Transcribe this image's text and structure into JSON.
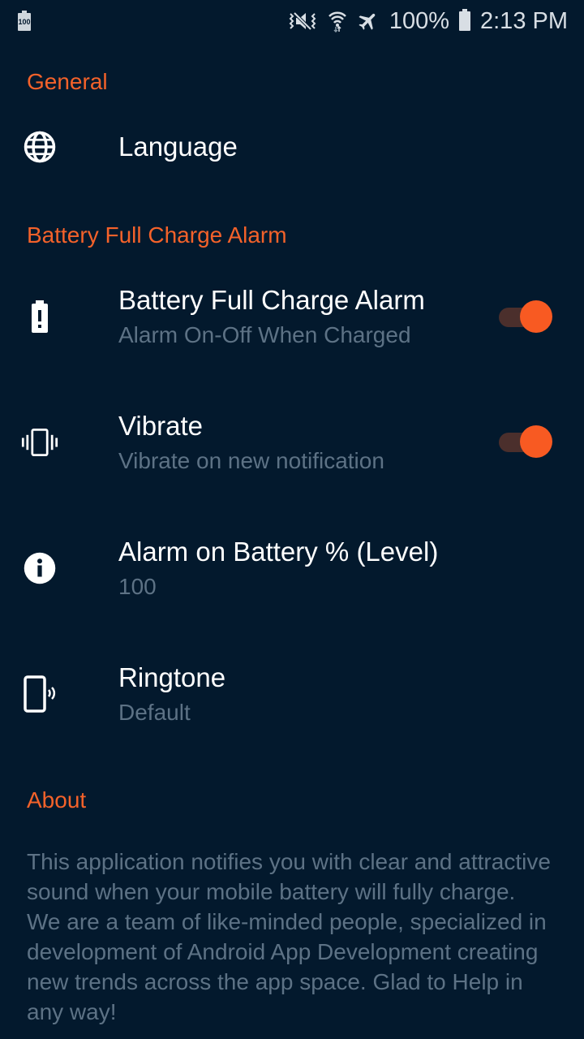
{
  "status_bar": {
    "left_icon": "battery-100-notification-icon",
    "left_icon_text": "100",
    "icons": [
      "vibrate-mute-icon",
      "wifi-icon",
      "airplane-mode-icon"
    ],
    "battery_percent": "100%",
    "time": "2:13 PM"
  },
  "sections": {
    "general": "General",
    "battery_alarm": "Battery Full Charge Alarm",
    "about": "About"
  },
  "settings": {
    "language": {
      "title": "Language",
      "icon": "globe-icon"
    },
    "battery_alarm": {
      "title": "Battery Full Charge Alarm",
      "subtitle": "Alarm On-Off When Charged",
      "icon": "battery-alert-icon",
      "enabled": true
    },
    "vibrate": {
      "title": "Vibrate",
      "subtitle": "Vibrate on new notification",
      "icon": "vibrate-icon",
      "enabled": true
    },
    "alarm_level": {
      "title": "Alarm on Battery % (Level)",
      "value": "100",
      "icon": "info-icon"
    },
    "ringtone": {
      "title": "Ringtone",
      "value": "Default",
      "icon": "ringtone-phone-icon"
    }
  },
  "about_text": "This application notifies you with clear and attractive sound when your mobile battery will fully charge.\nWe are a team of like-minded people, specialized in development of Android App Development creating new trends across the app space. Glad to Help in any way!",
  "colors": {
    "background": "#03192d",
    "accent": "#f4622a",
    "toggle_thumb": "#f85a22",
    "secondary_text": "#5d7285"
  }
}
